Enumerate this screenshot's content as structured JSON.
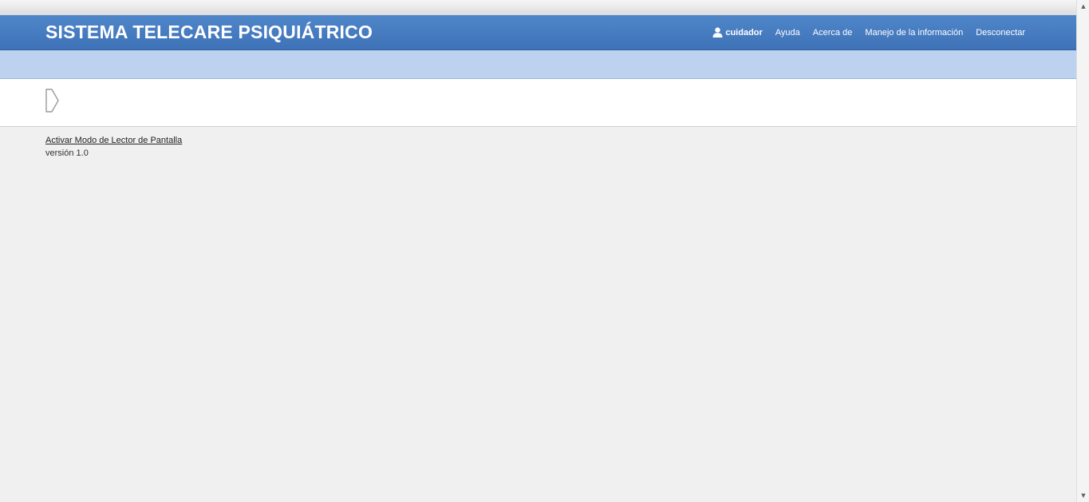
{
  "header": {
    "title": "SISTEMA TELECARE PSIQUIÁTRICO",
    "user": {
      "icon": "user-icon",
      "name": "cuidador"
    },
    "links": {
      "help": "Ayuda",
      "about": "Acerca de",
      "info": "Manejo de la información",
      "logout": "Desconectar"
    }
  },
  "sidebar_toggle": {
    "icon": "chevron-right-icon"
  },
  "footer": {
    "screen_reader_link": "Activar Modo de Lector de Pantalla",
    "version": "versión 1.0"
  },
  "colors": {
    "navbar": "#4679c1",
    "subbar": "#bcd2ee",
    "background": "#f0f0f0"
  }
}
